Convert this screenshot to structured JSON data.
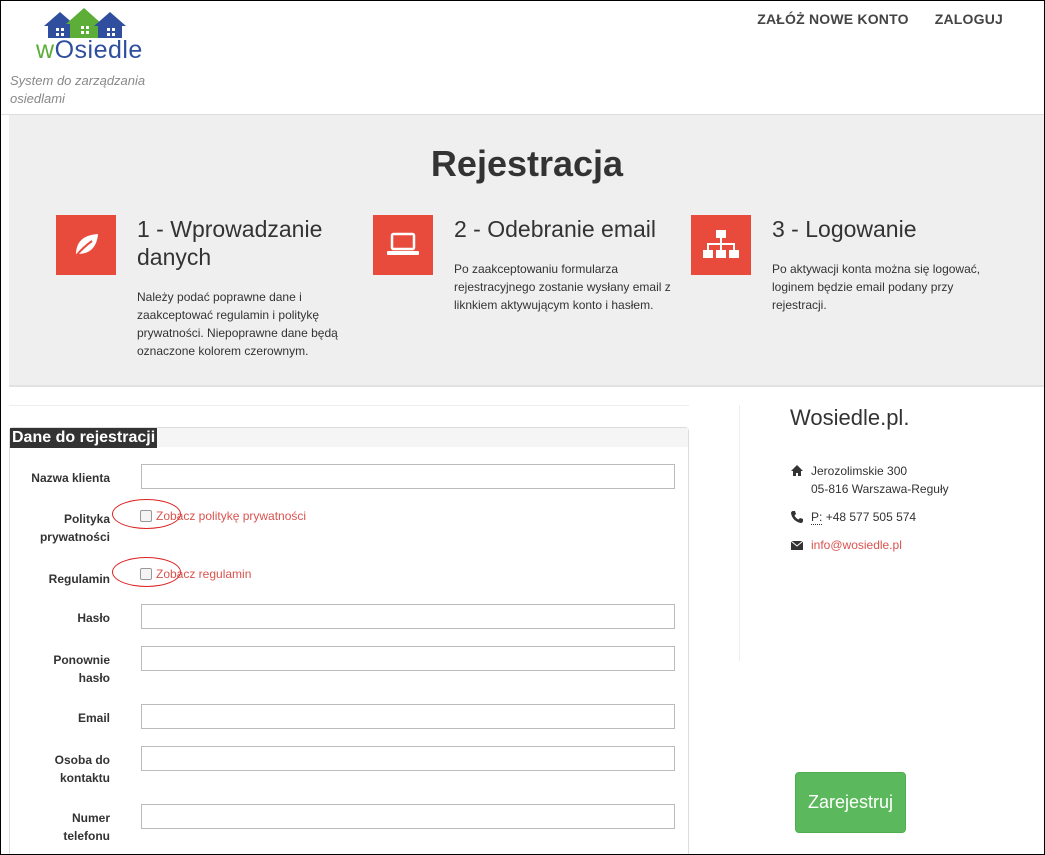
{
  "brand": {
    "logo_w": "w",
    "logo_rest": "Osiedle",
    "tagline": "System do zarządzania osiedlami"
  },
  "nav": {
    "register_label": "ZAŁÓŻ NOWE KONTO",
    "login_label": "ZALOGUJ"
  },
  "hero": {
    "title": "Rejestracja",
    "steps": [
      {
        "icon": "leaf-icon",
        "title": "1 - Wprowadzanie danych",
        "desc": "Należy podać poprawne dane i zaakceptować regulamin i politykę prywatności. Niepoprawne dane będą oznaczone kolorem czerownym."
      },
      {
        "icon": "laptop-icon",
        "title": "2 - Odebranie email",
        "desc": "Po zaakceptowaniu formularza rejestracyjnego zostanie wysłany email z liknkiem aktywującym konto i hasłem."
      },
      {
        "icon": "sitemap-icon",
        "title": "3 - Logowanie",
        "desc": "Po aktywacji konta można się logować, loginem będzie email podany przy rejestracji."
      }
    ]
  },
  "form": {
    "heading": "Dane do rejestracji",
    "fields": {
      "client_name": {
        "label": "Nazwa klienta",
        "value": ""
      },
      "privacy": {
        "label": "Polityka prywatności",
        "link": "Zobacz politykę prywatności",
        "checked": false
      },
      "terms": {
        "label": "Regulamin",
        "link": "Zobacz regulamin",
        "checked": false
      },
      "password": {
        "label": "Hasło",
        "value": ""
      },
      "password_repeat": {
        "label": "Ponownie hasło",
        "value": ""
      },
      "email": {
        "label": "Email",
        "value": ""
      },
      "contact_person": {
        "label": "Osoba do kontaktu",
        "value": ""
      },
      "phone": {
        "label": "Numer telefonu",
        "value": ""
      }
    },
    "submit_label": "Zarejestruj"
  },
  "contact": {
    "title": "Wosiedle.pl.",
    "address_line1": "Jerozolimskie 300",
    "address_line2": "05-816 Warszawa-Reguły",
    "phone_prefix": "P:",
    "phone": "+48 577 505 574",
    "email": "info@wosiedle.pl"
  },
  "colors": {
    "accent_red": "#e84a3c",
    "link_red": "#d9534f",
    "button_green": "#5cb85c",
    "logo_blue": "#2f4f9e",
    "logo_green": "#5dae39"
  }
}
